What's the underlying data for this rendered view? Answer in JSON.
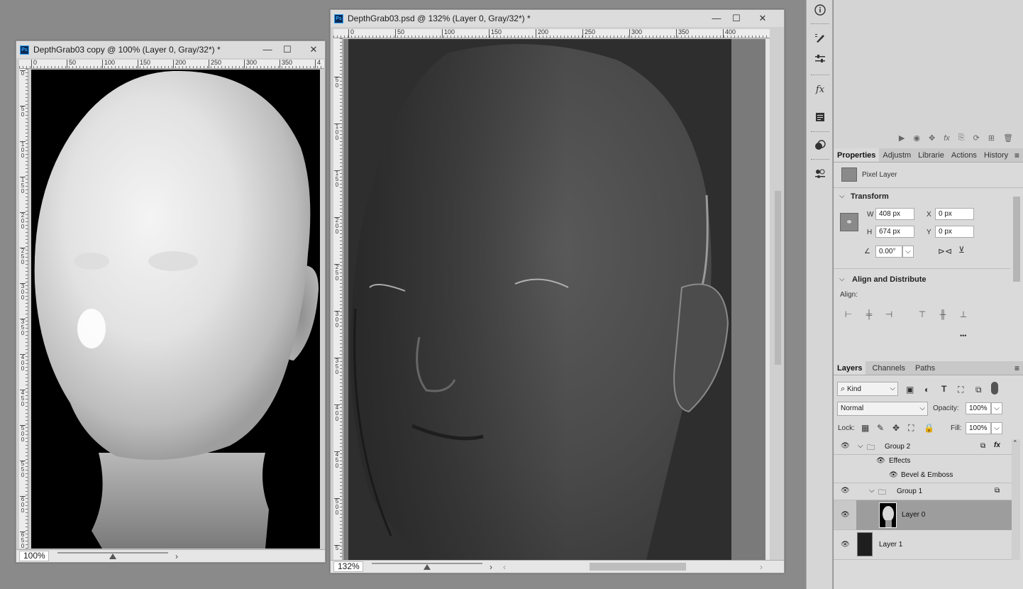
{
  "windows": {
    "left": {
      "title": "DepthGrab03 copy @ 100% (Layer 0, Gray/32*) *",
      "zoom": "100%",
      "ruler_h": [
        "0",
        "50",
        "100",
        "150",
        "200",
        "250",
        "300",
        "350",
        "4"
      ],
      "ruler_v": [
        "0",
        "50",
        "100",
        "150",
        "200",
        "250",
        "300",
        "350",
        "400",
        "450",
        "500",
        "550",
        "600",
        "650"
      ]
    },
    "right": {
      "title": "DepthGrab03.psd @ 132% (Layer 0, Gray/32*) *",
      "zoom": "132%",
      "ruler_h": [
        "0",
        "50",
        "100",
        "150",
        "200",
        "250",
        "300",
        "350",
        "400"
      ],
      "ruler_v": [
        "50",
        "100",
        "150",
        "200",
        "250",
        "300",
        "350",
        "400",
        "450",
        "500",
        "5"
      ]
    }
  },
  "window_controls": {
    "minimize": "—",
    "maximize": "☐",
    "close": "✕"
  },
  "sidebar_icons": [
    "info-icon",
    "brush-settings-icon",
    "adjustment-sliders-icon",
    "fx-icon",
    "notes-icon",
    "blend-icon",
    "properties-icon"
  ],
  "action_icons": [
    "play-icon",
    "eye-icon",
    "move-icon",
    "fx-icon",
    "export-icon",
    "refresh-icon",
    "new-icon",
    "trash-icon"
  ],
  "properties": {
    "tabs": [
      "Properties",
      "Adjustm",
      "Librarie",
      "Actions",
      "History"
    ],
    "layer_type": "Pixel Layer",
    "transform": {
      "header": "Transform",
      "w_label": "W",
      "w": "408 px",
      "h_label": "H",
      "h": "674 px",
      "x_label": "X",
      "x": "0 px",
      "y_label": "Y",
      "y": "0 px",
      "angle": "0.00°"
    },
    "align": {
      "header": "Align and Distribute",
      "label": "Align:",
      "more": "•••"
    }
  },
  "layers": {
    "tabs": [
      "Layers",
      "Channels",
      "Paths"
    ],
    "filter": "Kind",
    "blend_mode": "Normal",
    "opacity_label": "Opacity:",
    "opacity": "100%",
    "lock_label": "Lock:",
    "fill_label": "Fill:",
    "fill": "100%",
    "items": [
      {
        "name": "Group 2",
        "kind": "group"
      },
      {
        "name": "Effects",
        "kind": "effects"
      },
      {
        "name": "Bevel & Emboss",
        "kind": "effect"
      },
      {
        "name": "Group 1",
        "kind": "group"
      },
      {
        "name": "Layer 0",
        "kind": "pixel",
        "selected": true
      },
      {
        "name": "Layer 1",
        "kind": "pixel"
      }
    ]
  }
}
